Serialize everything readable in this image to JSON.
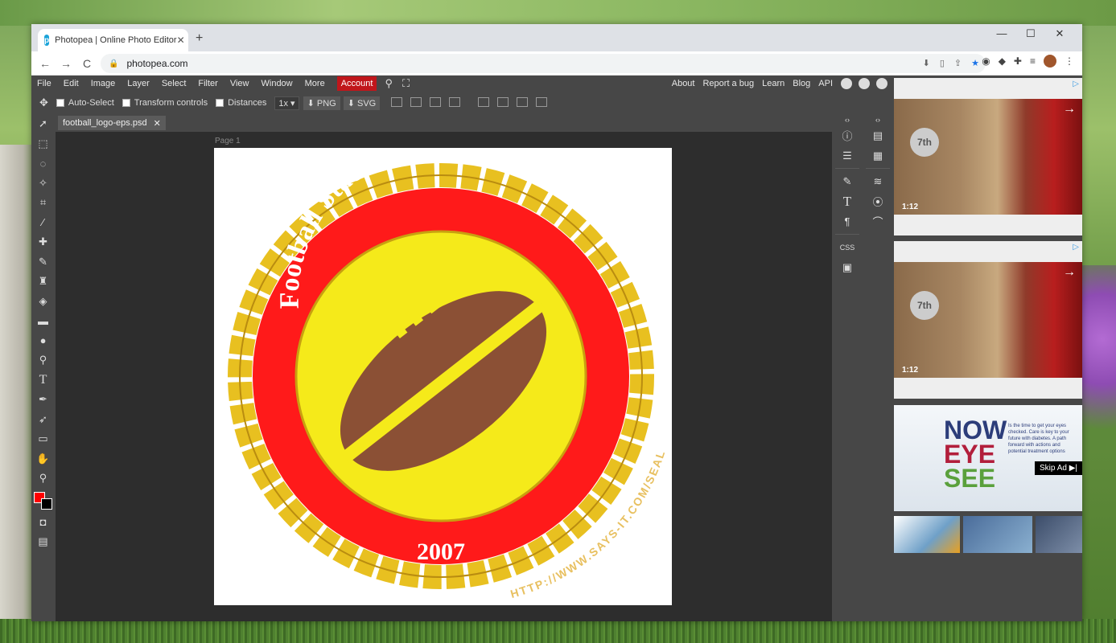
{
  "browser": {
    "tab_title": "Photopea | Online Photo Editor",
    "url": "photopea.com",
    "favicon_letter": "p",
    "new_tab": "+",
    "tab_close": "✕",
    "win_min": "—",
    "win_max": "☐",
    "win_close": "✕",
    "back": "←",
    "forward": "→",
    "reload": "C",
    "lock": "🔒"
  },
  "menu": {
    "items": [
      "File",
      "Edit",
      "Image",
      "Layer",
      "Select",
      "Filter",
      "View",
      "Window",
      "More"
    ],
    "account": "Account",
    "right": [
      "About",
      "Report a bug",
      "Learn",
      "Blog",
      "API"
    ]
  },
  "options": {
    "auto_select": "Auto-Select",
    "transform_controls": "Transform controls",
    "distances": "Distances",
    "zoom": "1x",
    "png": "PNG",
    "svg": "SVG"
  },
  "document": {
    "tab_name": "football_logo-eps.psd",
    "page_label": "Page 1"
  },
  "logo": {
    "title": "Football Stadium University",
    "year": "2007",
    "url_text": "HTTP://WWW.SAYS-IT.COM/SEAL/",
    "colors": {
      "red": "#ff1a1a",
      "yellow": "#f5ea1a",
      "gold": "#e8c020",
      "ball": "#8b5035"
    }
  },
  "swatches": {
    "foreground": "#ff0000",
    "background": "#000000"
  },
  "ads": {
    "video_time_1": "1:12",
    "video_time_2": "1:12",
    "badge": "7th",
    "arrow": "→",
    "banner_now": "NOW",
    "banner_eye": "EYE",
    "banner_see": "SEE",
    "banner_copy": "Is the time to get your eyes checked. Care is key to your future with diabetes. A path forward with actions and potential treatment options",
    "skip": "Skip Ad ▶|"
  }
}
